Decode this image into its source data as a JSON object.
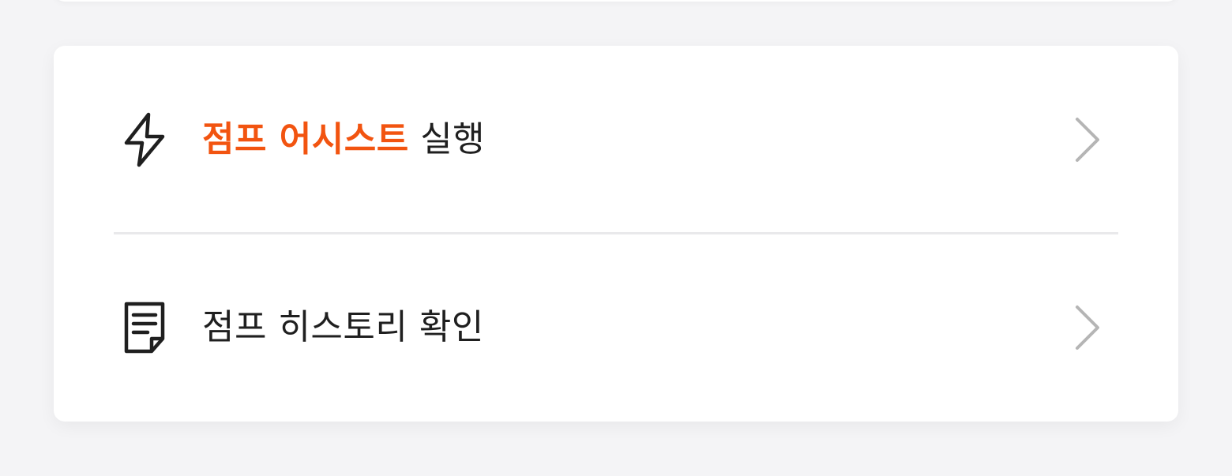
{
  "menu": {
    "items": [
      {
        "icon": "lightning-icon",
        "label_highlight": "점프 어시스트",
        "label_rest": " 실행",
        "chevron": "chevron-right-icon"
      },
      {
        "icon": "document-list-icon",
        "label": "점프 히스토리 확인",
        "chevron": "chevron-right-icon"
      }
    ]
  },
  "colors": {
    "accent": "#f25410",
    "text": "#1f1f1f",
    "chevron": "#b5b5b5",
    "divider": "#e9e9eb",
    "background": "#f4f4f6",
    "card": "#ffffff"
  }
}
